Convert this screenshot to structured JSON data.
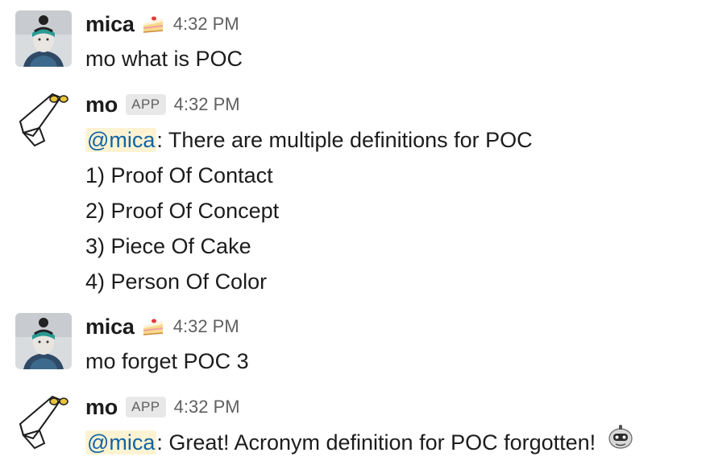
{
  "messages": [
    {
      "user": "mica",
      "status_emoji": "cake-icon",
      "time": "4:32 PM",
      "lines": [
        "mo what is POC"
      ]
    },
    {
      "user": "mo",
      "badge": "APP",
      "time": "4:32 PM",
      "mention": "@mica",
      "first_line_rest": ": There are multiple definitions for POC",
      "lines": [
        "1) Proof Of Contact",
        "2) Proof Of Concept",
        "3) Piece Of Cake",
        "4) Person Of Color"
      ]
    },
    {
      "user": "mica",
      "status_emoji": "cake-icon",
      "time": "4:32 PM",
      "lines": [
        "mo forget POC 3"
      ]
    },
    {
      "user": "mo",
      "badge": "APP",
      "time": "4:32 PM",
      "mention": "@mica",
      "first_line_rest": ": Great! Acronym definition for POC forgotten!",
      "trailing_emoji": "robot-face-icon"
    }
  ],
  "colors": {
    "text": "#1d1c1d",
    "timestamp": "#616061",
    "mention_text": "#1264a3",
    "mention_bg": "#fdf3d3",
    "badge_bg": "#e8e8e8"
  }
}
